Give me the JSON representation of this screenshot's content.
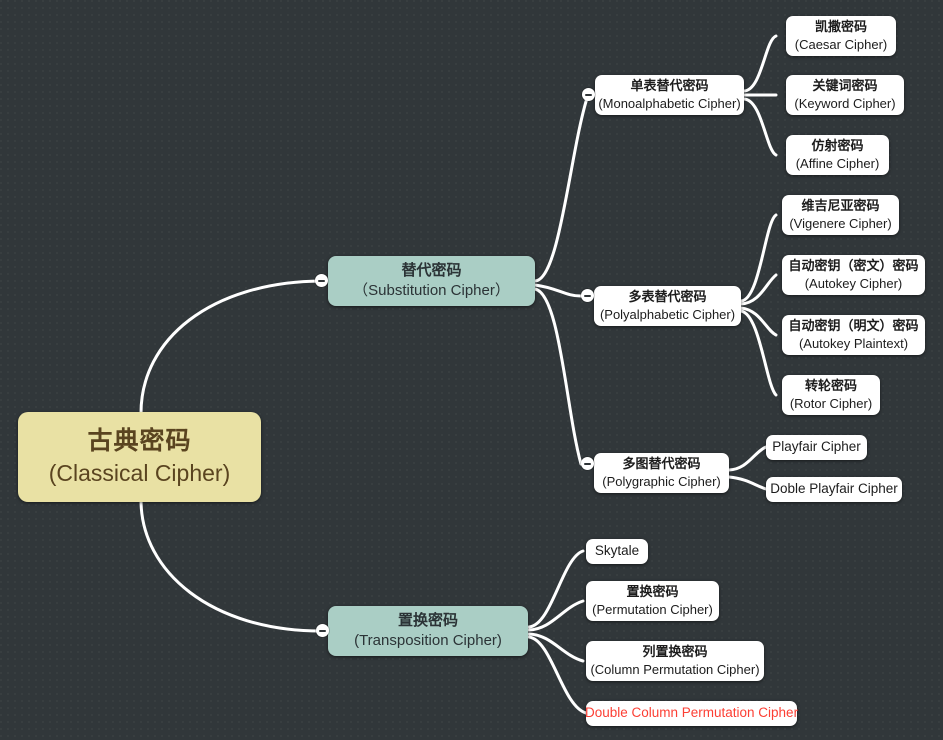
{
  "canvas": {
    "background_color": "#31373a",
    "dot_color": "#3a4043",
    "edge_color": "#ffffff"
  },
  "colors": {
    "root_fill": "#e9e1a4",
    "root_text": "#5a4420",
    "level2_fill": "#aacec5",
    "level2_text": "#2b3336",
    "node_fill": "#ffffff",
    "node_text": "#1c1c1c",
    "alert_text": "#fc3f34"
  },
  "root": {
    "cn": "古典密码",
    "en": "(Classical Cipher)"
  },
  "branches": [
    {
      "id": "substitution",
      "cn": "替代密码",
      "en": "（Substitution Cipher）",
      "toggle": "collapse-minus-icon",
      "children": [
        {
          "id": "monoalphabetic",
          "cn": "单表替代密码",
          "en": "(Monoalphabetic Cipher)",
          "toggle": "collapse-minus-icon",
          "children": [
            {
              "id": "caesar",
              "cn": "凯撒密码",
              "en": "(Caesar Cipher)"
            },
            {
              "id": "keyword",
              "cn": "关键词密码",
              "en": "(Keyword Cipher)"
            },
            {
              "id": "affine",
              "cn": "仿射密码",
              "en": "(Affine Cipher)"
            }
          ]
        },
        {
          "id": "polyalphabetic",
          "cn": "多表替代密码",
          "en": "(Polyalphabetic Cipher)",
          "toggle": "collapse-minus-icon",
          "children": [
            {
              "id": "vigenere",
              "cn": "维吉尼亚密码",
              "en": "(Vigenere Cipher)"
            },
            {
              "id": "autokey-cipher",
              "cn": "自动密钥（密文）密码",
              "en": "(Autokey Cipher)"
            },
            {
              "id": "autokey-plaintext",
              "cn": "自动密钥（明文）密码",
              "en": "(Autokey Plaintext)"
            },
            {
              "id": "rotor",
              "cn": "转轮密码",
              "en": "(Rotor Cipher)"
            }
          ]
        },
        {
          "id": "polygraphic",
          "cn": "多图替代密码",
          "en": "(Polygraphic Cipher)",
          "toggle": "collapse-minus-icon",
          "children": [
            {
              "id": "playfair",
              "cn": "",
              "en": "Playfair Cipher"
            },
            {
              "id": "doble-playfair",
              "cn": "",
              "en": "Doble Playfair Cipher"
            }
          ]
        }
      ]
    },
    {
      "id": "transposition",
      "cn": "置换密码",
      "en": "(Transposition Cipher)",
      "toggle": "collapse-minus-icon",
      "children": [
        {
          "id": "skytale",
          "cn": "",
          "en": "Skytale"
        },
        {
          "id": "permutation",
          "cn": "置换密码",
          "en": "(Permutation Cipher)"
        },
        {
          "id": "column-permutation",
          "cn": "列置换密码",
          "en": "(Column Permutation Cipher)"
        },
        {
          "id": "double-column",
          "cn": "",
          "en": "Double Column Permutation Cipher",
          "alert": true
        }
      ]
    }
  ]
}
